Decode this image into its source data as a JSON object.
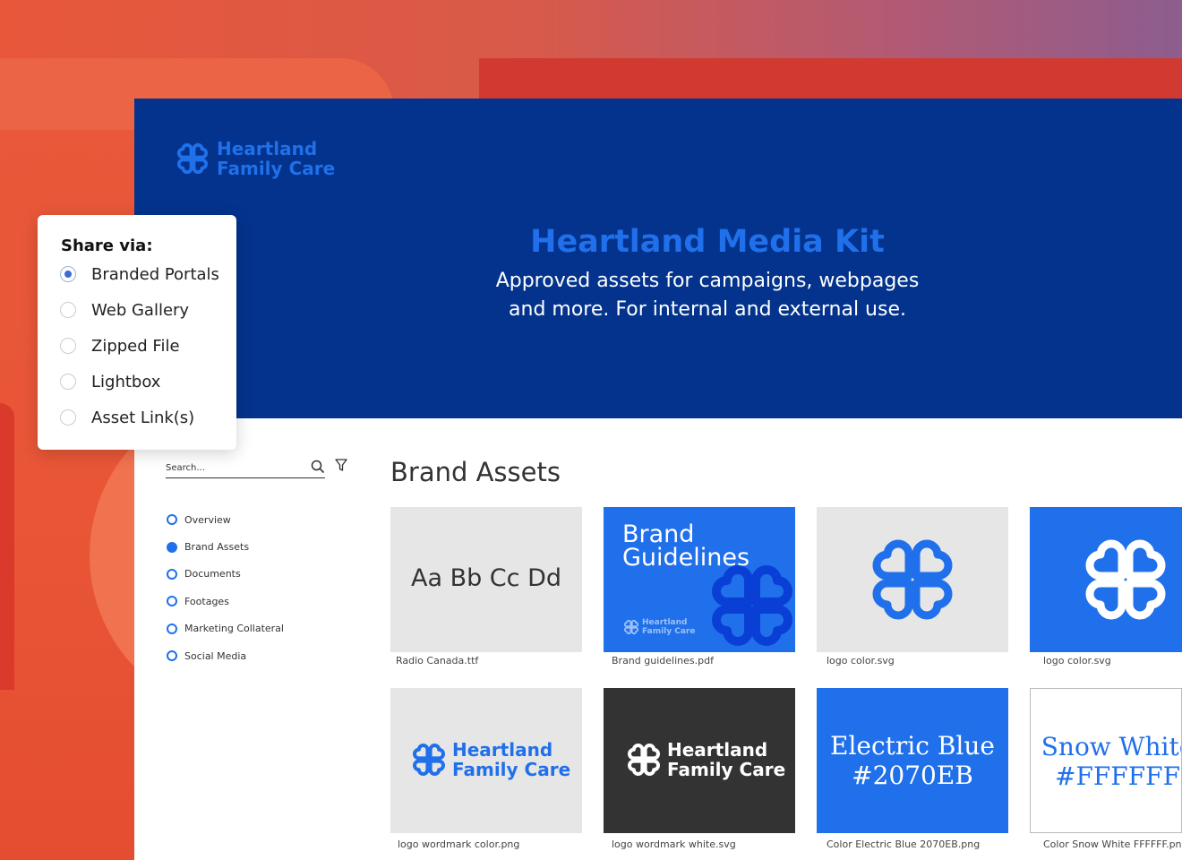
{
  "brand": {
    "line1": "Heartland",
    "line2": "Family Care"
  },
  "hero": {
    "title": "Heartland Media Kit",
    "subtitle_line1": "Approved assets for campaigns, webpages",
    "subtitle_line2": "and more. For internal and external use."
  },
  "share": {
    "title": "Share via:",
    "options": [
      {
        "label": "Branded Portals",
        "selected": true
      },
      {
        "label": "Web Gallery",
        "selected": false
      },
      {
        "label": "Zipped File",
        "selected": false
      },
      {
        "label": "Lightbox",
        "selected": false
      },
      {
        "label": "Asset Link(s)",
        "selected": false
      }
    ]
  },
  "search": {
    "placeholder": "Search..."
  },
  "nav": {
    "items": [
      {
        "label": "Overview",
        "active": false
      },
      {
        "label": "Brand Assets",
        "active": true
      },
      {
        "label": "Documents",
        "active": false
      },
      {
        "label": "Footages",
        "active": false
      },
      {
        "label": "Marketing Collateral",
        "active": false
      },
      {
        "label": "Social Media",
        "active": false
      }
    ]
  },
  "content": {
    "title": "Brand Assets"
  },
  "assets": [
    {
      "filename": "Radio Canada.ttf",
      "preview_text": "Aa Bb Cc Dd"
    },
    {
      "filename": "Brand guidelines.pdf",
      "preview_line1": "Brand",
      "preview_line2": "Guidelines"
    },
    {
      "filename": "logo color.svg"
    },
    {
      "filename": "logo color.svg"
    },
    {
      "filename": "logo wordmark color.png"
    },
    {
      "filename": "logo wordmark white.svg"
    },
    {
      "filename": "Color Electric Blue 2070EB.png",
      "preview_line1": "Electric Blue",
      "preview_line2": "#2070EB"
    },
    {
      "filename": "Color Snow White FFFFFF.png",
      "preview_line1": "Snow White",
      "preview_line2": "#FFFFFF"
    }
  ],
  "colors": {
    "electric_blue": "#2070EB",
    "navy": "#03338C",
    "snow_white": "#FFFFFF",
    "tile_grey": "#E6E6E6",
    "tile_dark": "#333333"
  },
  "icons": [
    "heartland-logo-icon",
    "search-icon",
    "filter-icon"
  ]
}
